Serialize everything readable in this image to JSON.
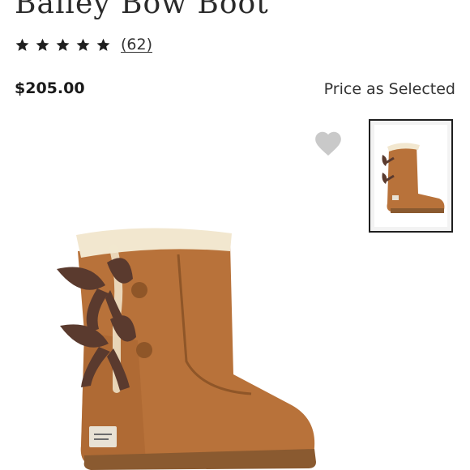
{
  "product": {
    "title": "Bailey Bow Boot",
    "rating": {
      "stars": 5,
      "max": 5,
      "review_count": "(62)"
    },
    "price": "$205.00",
    "price_note": "Price as Selected"
  },
  "icons": {
    "star": "star-icon",
    "wishlist": "heart-icon"
  },
  "colors": {
    "text": "#1f1f1f",
    "heart": "#c9c9c9",
    "boot_chestnut": "#b8723a",
    "ribbon": "#5a3a2e",
    "fur": "#f2e7cf"
  }
}
